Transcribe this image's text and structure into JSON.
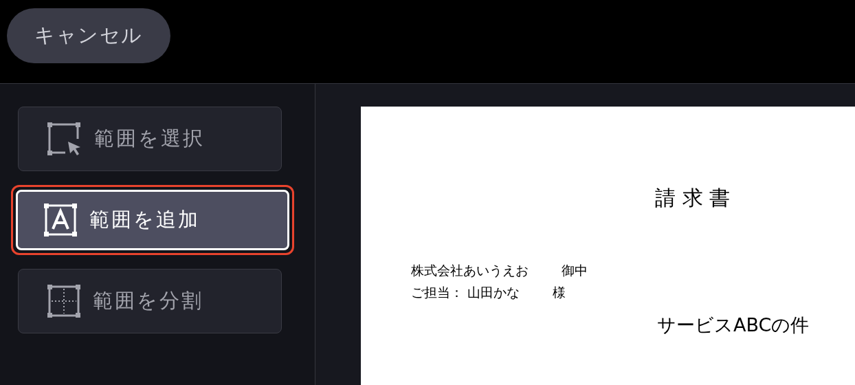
{
  "cancel_button": {
    "label": "キャンセル"
  },
  "tools": [
    {
      "kind": "select",
      "label": "範囲を選択",
      "selected": false
    },
    {
      "kind": "add",
      "label": "範囲を追加",
      "selected": true
    },
    {
      "kind": "split",
      "label": "範囲を分割",
      "selected": false
    }
  ],
  "document": {
    "title": "請 求 書",
    "recipient_lines": [
      {
        "name": "株式会社あいうえお",
        "honorific": "御中"
      },
      {
        "name": "ご担当： 山田かな",
        "honorific": "様"
      }
    ],
    "subject": "サービスABCの件"
  }
}
